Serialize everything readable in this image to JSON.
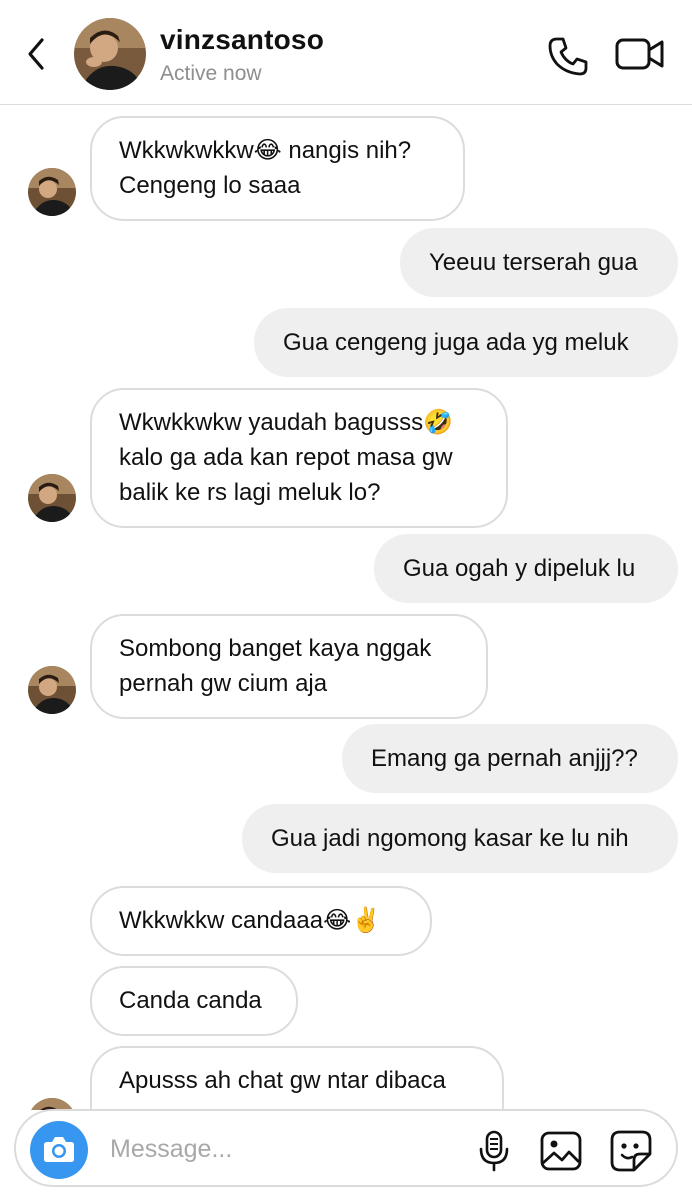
{
  "header": {
    "username": "vinzsantoso",
    "status": "Active now"
  },
  "icons": {
    "back": "chevron-left-icon",
    "call": "phone-icon",
    "video": "video-camera-icon",
    "camera": "camera-icon",
    "mic": "microphone-icon",
    "gallery": "image-icon",
    "sticker": "sticker-icon"
  },
  "colors": {
    "accent": "#3797f0",
    "outgoing_bubble": "#efefef",
    "incoming_border": "#dcdcdc",
    "muted_text": "#8e8e8e"
  },
  "messages": [
    {
      "from": "them",
      "text": "Wkkwkwkkw😂 nangis nih?\nCengeng lo saaa"
    },
    {
      "from": "me",
      "text": "Yeeuu terserah gua"
    },
    {
      "from": "me",
      "text": "Gua cengeng juga ada yg meluk"
    },
    {
      "from": "them",
      "text": "Wkwkkwkw yaudah bagusss🤣\nkalo ga ada kan repot masa gw\nbalik ke rs lagi meluk lo?"
    },
    {
      "from": "me",
      "text": "Gua ogah y dipeluk lu"
    },
    {
      "from": "them",
      "text": "Sombong banget kaya nggak\npernah gw cium aja"
    },
    {
      "from": "me",
      "text": "Emang ga pernah anjjj??"
    },
    {
      "from": "me",
      "text": "Gua jadi ngomong kasar ke lu nih"
    },
    {
      "from": "them",
      "text": "Wkkwkkw candaaa😂✌️"
    },
    {
      "from": "them",
      "text": "Canda canda"
    },
    {
      "from": "them",
      "text": "Apusss ah chat gw ntar dibaca"
    }
  ],
  "composer": {
    "placeholder": "Message..."
  }
}
